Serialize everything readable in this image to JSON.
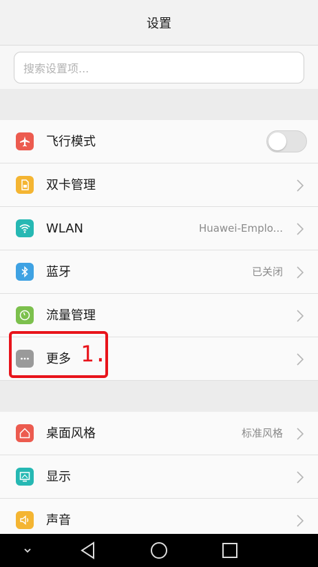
{
  "header": {
    "title": "设置"
  },
  "search": {
    "placeholder": "搜索设置项..."
  },
  "section1": [
    {
      "label": "飞行模式",
      "icon": "airplane-icon",
      "color": "#ec5b4f",
      "toggle": false
    },
    {
      "label": "双卡管理",
      "icon": "sim-card-icon",
      "color": "#f4b532"
    },
    {
      "label": "WLAN",
      "icon": "wifi-icon",
      "color": "#26b8b3",
      "value": "Huawei-Emplo..."
    },
    {
      "label": "蓝牙",
      "icon": "bluetooth-icon",
      "color": "#3fa2e3",
      "value": "已关闭"
    },
    {
      "label": "流量管理",
      "icon": "data-usage-icon",
      "color": "#7cc04d"
    },
    {
      "label": "更多",
      "icon": "more-icon",
      "color": "#9a9a9a"
    }
  ],
  "section2": [
    {
      "label": "桌面风格",
      "icon": "home-icon",
      "color": "#ec5b4f",
      "value": "标准风格"
    },
    {
      "label": "显示",
      "icon": "display-icon",
      "color": "#26b8b3"
    },
    {
      "label": "声音",
      "icon": "sound-icon",
      "color": "#f4b532"
    }
  ],
  "annotation": {
    "text": "1.",
    "color": "#e8141b"
  },
  "navbar": {
    "buttons": [
      "collapse-icon",
      "back-icon",
      "home-circle-icon",
      "recents-icon"
    ]
  }
}
